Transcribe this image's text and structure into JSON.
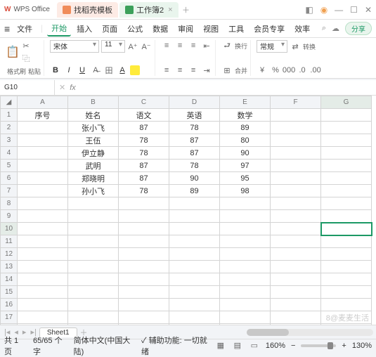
{
  "title": {
    "logo": "W",
    "app": "WPS Office"
  },
  "tabs": [
    {
      "label": "找稻壳模板"
    },
    {
      "label": "工作簿2"
    }
  ],
  "menu": {
    "file": "文件",
    "items": [
      "开始",
      "插入",
      "页面",
      "公式",
      "数据",
      "审阅",
      "视图",
      "工具",
      "会员专享",
      "效率"
    ],
    "activeIndex": 0,
    "share": "分享"
  },
  "ribbon": {
    "paste": "粘贴",
    "format": "格式刷",
    "font": "宋体",
    "size": "11",
    "wrap": "换行",
    "merge": "合并",
    "numfmt": "常规",
    "convert": "转换",
    "percent": "%",
    "thousand": "000",
    "decInc": ".0",
    "decDec": ".00"
  },
  "namebox": "G10",
  "cols": [
    "A",
    "B",
    "C",
    "D",
    "E",
    "F",
    "G"
  ],
  "headers": {
    "A": "序号",
    "B": "姓名",
    "C": "语文",
    "D": "英语",
    "E": "数学"
  },
  "rows": [
    {
      "B": "张小飞",
      "C": "87",
      "D": "78",
      "E": "89"
    },
    {
      "B": "王伍",
      "C": "78",
      "D": "87",
      "E": "80"
    },
    {
      "B": "伊立静",
      "C": "78",
      "D": "87",
      "E": "90"
    },
    {
      "B": "武明",
      "C": "87",
      "D": "78",
      "E": "97"
    },
    {
      "B": "郑晓明",
      "C": "87",
      "D": "90",
      "E": "95"
    },
    {
      "B": "孙小飞",
      "C": "78",
      "D": "89",
      "E": "98"
    }
  ],
  "selected": {
    "col": "G",
    "row": 10
  },
  "sheet": "Sheet1",
  "status": {
    "pages": "共 1 页",
    "chars": "65/65 个字",
    "lang": "简体中文(中国大陆)",
    "assist": "辅助功能: 一切就绪",
    "zoom": "160%",
    "zoom2": "130%"
  },
  "watermark": "8@麦麦生活"
}
